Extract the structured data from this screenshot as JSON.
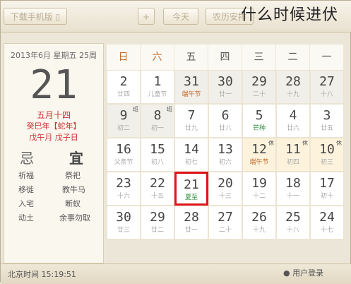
{
  "toolbar": {
    "download_label": "下载手机版",
    "add_label": "+",
    "today_label": "今天",
    "lunar_label": "农历安排"
  },
  "overlay_text": "什么时候进伏",
  "left_panel": {
    "date_line": "2013年6月  星期五  25周",
    "big_day": "21",
    "lunar_month": "五月十四",
    "ganzhi1": "癸巳年【蛇年】",
    "ganzhi2": "戊午月 戊子日",
    "bad_label": "忌",
    "good_label": "宜",
    "bad_items": [
      "祈福",
      "移徙",
      "入宅",
      "动土"
    ],
    "good_items": [
      "祭祀",
      "教牛马",
      "断蚁",
      "余事勿取"
    ]
  },
  "weekdays": [
    "一",
    "二",
    "三",
    "四",
    "五",
    "六",
    "日"
  ],
  "weeks": [
    [
      {
        "d": "27",
        "l": "十八"
      },
      {
        "d": "28",
        "l": "十九"
      },
      {
        "d": "29",
        "l": "二十"
      },
      {
        "d": "30",
        "l": "廿一"
      },
      {
        "d": "31",
        "l": "端午节"
      },
      {
        "d": "1",
        "l": "儿童节"
      },
      {
        "d": "2",
        "l": "廿四"
      }
    ],
    [
      {
        "d": "3",
        "l": "廿五"
      },
      {
        "d": "4",
        "l": "廿六"
      },
      {
        "d": "5",
        "l": "芒种"
      },
      {
        "d": "6",
        "l": "廿八"
      },
      {
        "d": "7",
        "l": "廿九"
      },
      {
        "d": "8",
        "l": "初一",
        "badge": "班"
      },
      {
        "d": "9",
        "l": "初二",
        "badge": "班"
      }
    ],
    [
      {
        "d": "10",
        "l": "初三",
        "badge": "休"
      },
      {
        "d": "11",
        "l": "初四",
        "badge": "休"
      },
      {
        "d": "12",
        "l": "端午节",
        "badge": "休"
      },
      {
        "d": "13",
        "l": "初六"
      },
      {
        "d": "14",
        "l": "初七"
      },
      {
        "d": "15",
        "l": "初八"
      },
      {
        "d": "16",
        "l": "父亲节"
      }
    ],
    [
      {
        "d": "17",
        "l": "初十"
      },
      {
        "d": "18",
        "l": "十一"
      },
      {
        "d": "19",
        "l": "十二"
      },
      {
        "d": "20",
        "l": "十三"
      },
      {
        "d": "21",
        "l": "夏至"
      },
      {
        "d": "22",
        "l": "十五"
      },
      {
        "d": "23",
        "l": "十六"
      }
    ],
    [
      {
        "d": "24",
        "l": "十七"
      },
      {
        "d": "25",
        "l": "十八"
      },
      {
        "d": "26",
        "l": "十九"
      },
      {
        "d": "27",
        "l": "二十"
      },
      {
        "d": "28",
        "l": "廿一"
      },
      {
        "d": "29",
        "l": "廿二"
      },
      {
        "d": "30",
        "l": "廿三"
      }
    ]
  ],
  "status": {
    "time_text": "北京时间 15:19:51",
    "login_label": "用户登录"
  }
}
